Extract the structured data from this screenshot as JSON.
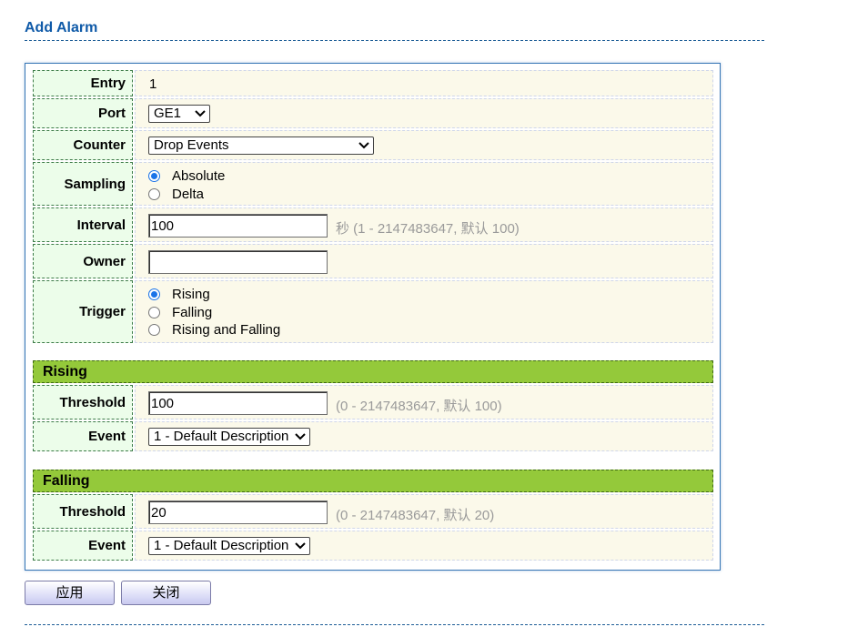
{
  "page": {
    "title": "Add Alarm"
  },
  "form": {
    "entry": {
      "label": "Entry",
      "value": "1"
    },
    "port": {
      "label": "Port",
      "selected": "GE1"
    },
    "counter": {
      "label": "Counter",
      "selected": "Drop Events"
    },
    "sampling": {
      "label": "Sampling",
      "options": [
        "Absolute",
        "Delta"
      ],
      "selected": "Absolute"
    },
    "interval": {
      "label": "Interval",
      "value": "100",
      "hint": "秒 (1 - 2147483647, 默认 100)"
    },
    "owner": {
      "label": "Owner",
      "value": ""
    },
    "trigger": {
      "label": "Trigger",
      "options": [
        "Rising",
        "Falling",
        "Rising and Falling"
      ],
      "selected": "Rising"
    }
  },
  "rising": {
    "header": "Rising",
    "threshold": {
      "label": "Threshold",
      "value": "100",
      "hint": "(0 - 2147483647, 默认 100)"
    },
    "event": {
      "label": "Event",
      "selected": "1 - Default Description"
    }
  },
  "falling": {
    "header": "Falling",
    "threshold": {
      "label": "Threshold",
      "value": "20",
      "hint": "(0 - 2147483647, 默认 20)"
    },
    "event": {
      "label": "Event",
      "selected": "1 - Default Description"
    }
  },
  "buttons": {
    "apply": "应用",
    "close": "关闭"
  },
  "colors": {
    "title": "#0f5aa8",
    "label_bg": "#ecfdea",
    "value_bg": "#fbf9ea",
    "section_bg": "#94c93a",
    "radio_accent": "#1a73e8",
    "hint": "#9a9a9a"
  }
}
